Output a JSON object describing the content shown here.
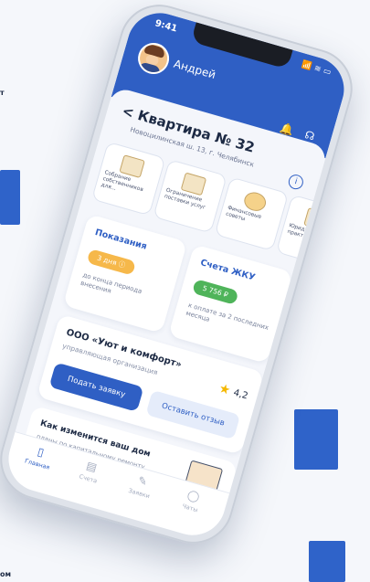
{
  "background": {
    "fragment_text_top": "т",
    "fragment_text_bottom": "ом",
    "accent_color": "#2f63c9"
  },
  "status_bar": {
    "time": "9:41",
    "signal": "📶",
    "wifi": "≋",
    "battery": "▭"
  },
  "header": {
    "user_name": "Андрей",
    "notification_icon": "bell-add-icon",
    "support_icon": "headset-icon"
  },
  "property": {
    "title": "< Квартира № 32",
    "address": "Новоцилинская ш. 13, г. Челябинск",
    "info_icon": "i"
  },
  "services": [
    {
      "label": "Собрание собственников для..."
    },
    {
      "label": "Ограничение поставки услуг"
    },
    {
      "label": "Финансовые советы"
    },
    {
      "label": "Юридическая практика"
    }
  ],
  "meters_card": {
    "title": "Показания",
    "badge": "3 дня ⓘ",
    "subtitle": "до конца периода внесения"
  },
  "accounts_card": {
    "title": "Счета ЖКУ",
    "badge": "5 756 ₽",
    "subtitle": "к оплате за 2 последних месяца"
  },
  "organization": {
    "name": "ООО «Уют и комфорт»",
    "type": "управляющая организация",
    "rating": "4,2",
    "primary_button": "Подать заявку",
    "secondary_button": "Оставить отзыв"
  },
  "promo": {
    "title": "Как изменится ваш дом",
    "subtitle": "планы по капитальному ремонту"
  },
  "tabs": [
    {
      "label": "Главная",
      "icon": "▯",
      "active": true
    },
    {
      "label": "Счета",
      "icon": "▤",
      "active": false
    },
    {
      "label": "Заявки",
      "icon": "✎",
      "active": false
    },
    {
      "label": "Чаты",
      "icon": "◯",
      "active": false
    }
  ],
  "colors": {
    "brand_blue": "#2f5fc4",
    "badge_orange": "#f6b84a",
    "badge_green": "#4fb45a",
    "star": "#f5b800"
  }
}
